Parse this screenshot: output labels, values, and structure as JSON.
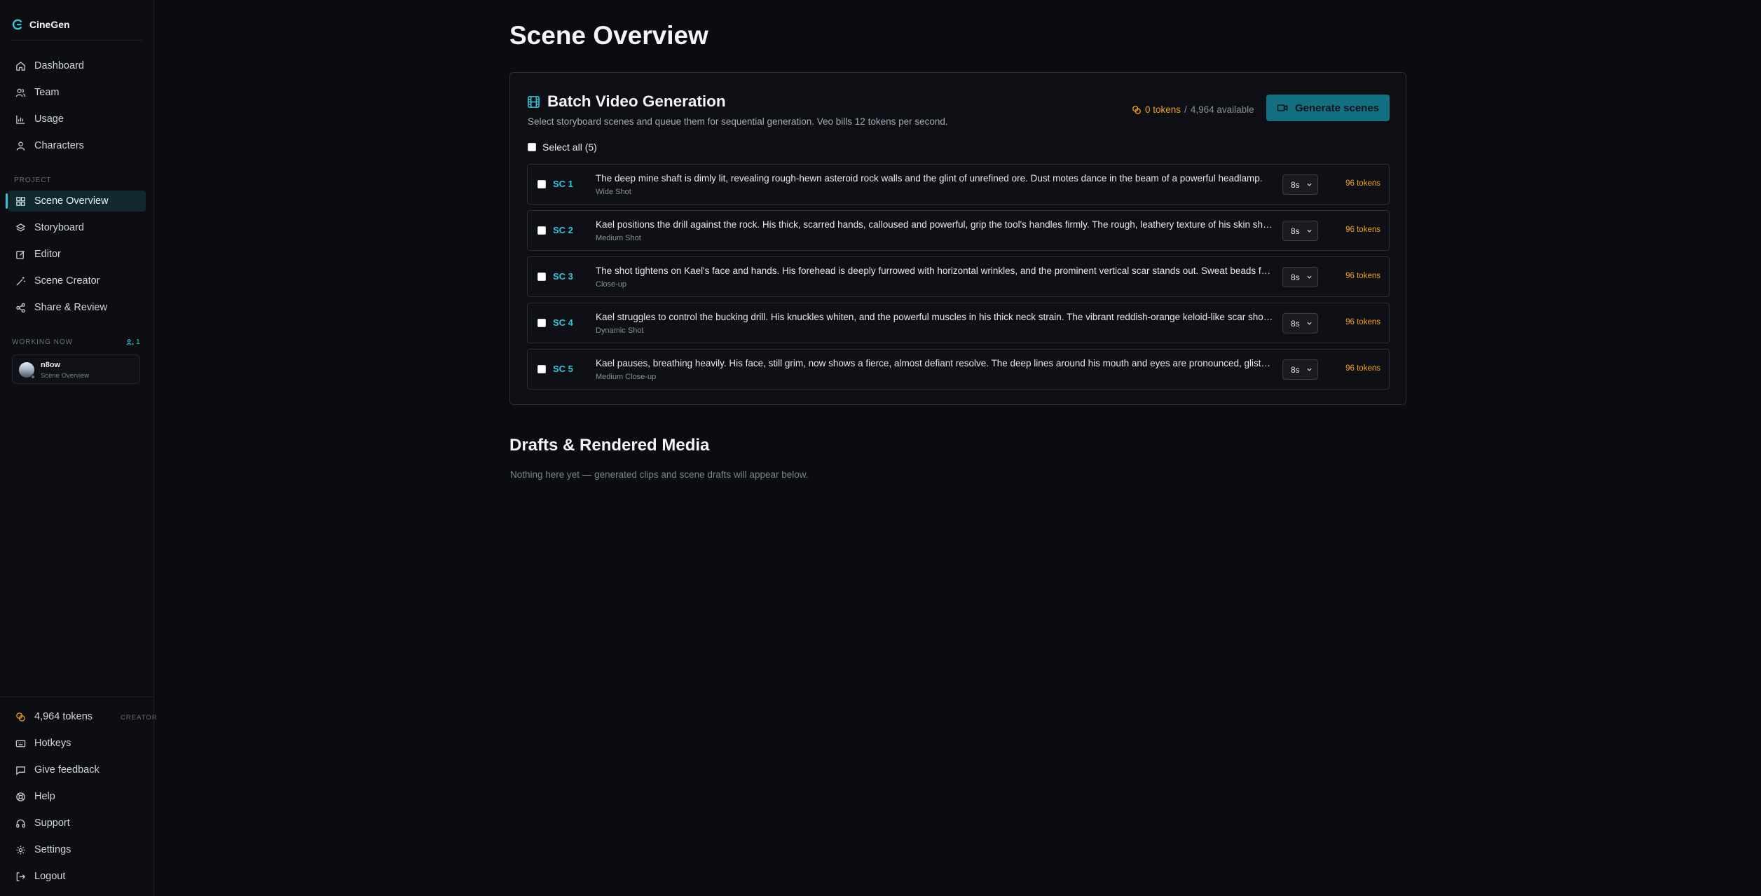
{
  "app": {
    "name": "CineGen"
  },
  "sidebar": {
    "main_items": [
      {
        "label": "Dashboard",
        "icon": "home-icon"
      },
      {
        "label": "Team",
        "icon": "users-icon"
      },
      {
        "label": "Usage",
        "icon": "bar-chart-icon"
      },
      {
        "label": "Characters",
        "icon": "user-icon"
      }
    ],
    "project_label": "PROJECT",
    "project_items": [
      {
        "label": "Scene Overview",
        "icon": "grid-icon",
        "active": true
      },
      {
        "label": "Storyboard",
        "icon": "layers-icon"
      },
      {
        "label": "Editor",
        "icon": "edit-icon"
      },
      {
        "label": "Scene Creator",
        "icon": "wand-icon"
      },
      {
        "label": "Share & Review",
        "icon": "share-icon"
      }
    ],
    "working_now_label": "WORKING NOW",
    "working_count": "1",
    "current_user": {
      "name": "n8ow",
      "page": "Scene Overview"
    },
    "bottom_items": {
      "tokens": "4,964 tokens",
      "role": "CREATOR",
      "hotkeys": "Hotkeys",
      "feedback": "Give feedback",
      "help": "Help",
      "support": "Support",
      "settings": "Settings",
      "logout": "Logout"
    }
  },
  "main": {
    "title": "Scene Overview",
    "batch": {
      "title": "Batch Video Generation",
      "subtitle": "Select storyboard scenes and queue them for sequential generation. Veo bills 12 tokens per second.",
      "selected_tokens": "0 tokens",
      "available": "4,964 available",
      "generate_label": "Generate scenes",
      "select_all_label": "Select all (5)",
      "scenes": [
        {
          "id": "SC 1",
          "description": "The deep mine shaft is dimly lit, revealing rough-hewn asteroid rock walls and the glint of unrefined ore. Dust motes dance in the beam of a powerful headlamp.",
          "shot": "Wide Shot",
          "duration": "8s",
          "tokens": "96 tokens"
        },
        {
          "id": "SC 2",
          "description": "Kael positions the drill against the rock. His thick, scarred hands, calloused and powerful, grip the tool's handles firmly. The rough, leathery texture of his skin shows.",
          "shot": "Medium Shot",
          "duration": "8s",
          "tokens": "96 tokens"
        },
        {
          "id": "SC 3",
          "description": "The shot tightens on Kael's face and hands. His forehead is deeply furrowed with horizontal wrinkles, and the prominent vertical scar stands out. Sweat beads form.",
          "shot": "Close-up",
          "duration": "8s",
          "tokens": "96 tokens"
        },
        {
          "id": "SC 4",
          "description": "Kael struggles to control the bucking drill. His knuckles whiten, and the powerful muscles in his thick neck strain. The vibrant reddish-orange keloid-like scar shows.",
          "shot": "Dynamic Shot",
          "duration": "8s",
          "tokens": "96 tokens"
        },
        {
          "id": "SC 5",
          "description": "Kael pauses, breathing heavily. His face, still grim, now shows a fierce, almost defiant resolve. The deep lines around his mouth and eyes are pronounced, glistening.",
          "shot": "Medium Close-up",
          "duration": "8s",
          "tokens": "96 tokens"
        }
      ]
    },
    "drafts": {
      "title": "Drafts & Rendered Media",
      "empty": "Nothing here yet — generated clips and scene drafts will appear below."
    }
  },
  "colors": {
    "accent": "#33c6d8",
    "token": "#f0a21b",
    "button": "#137083"
  }
}
